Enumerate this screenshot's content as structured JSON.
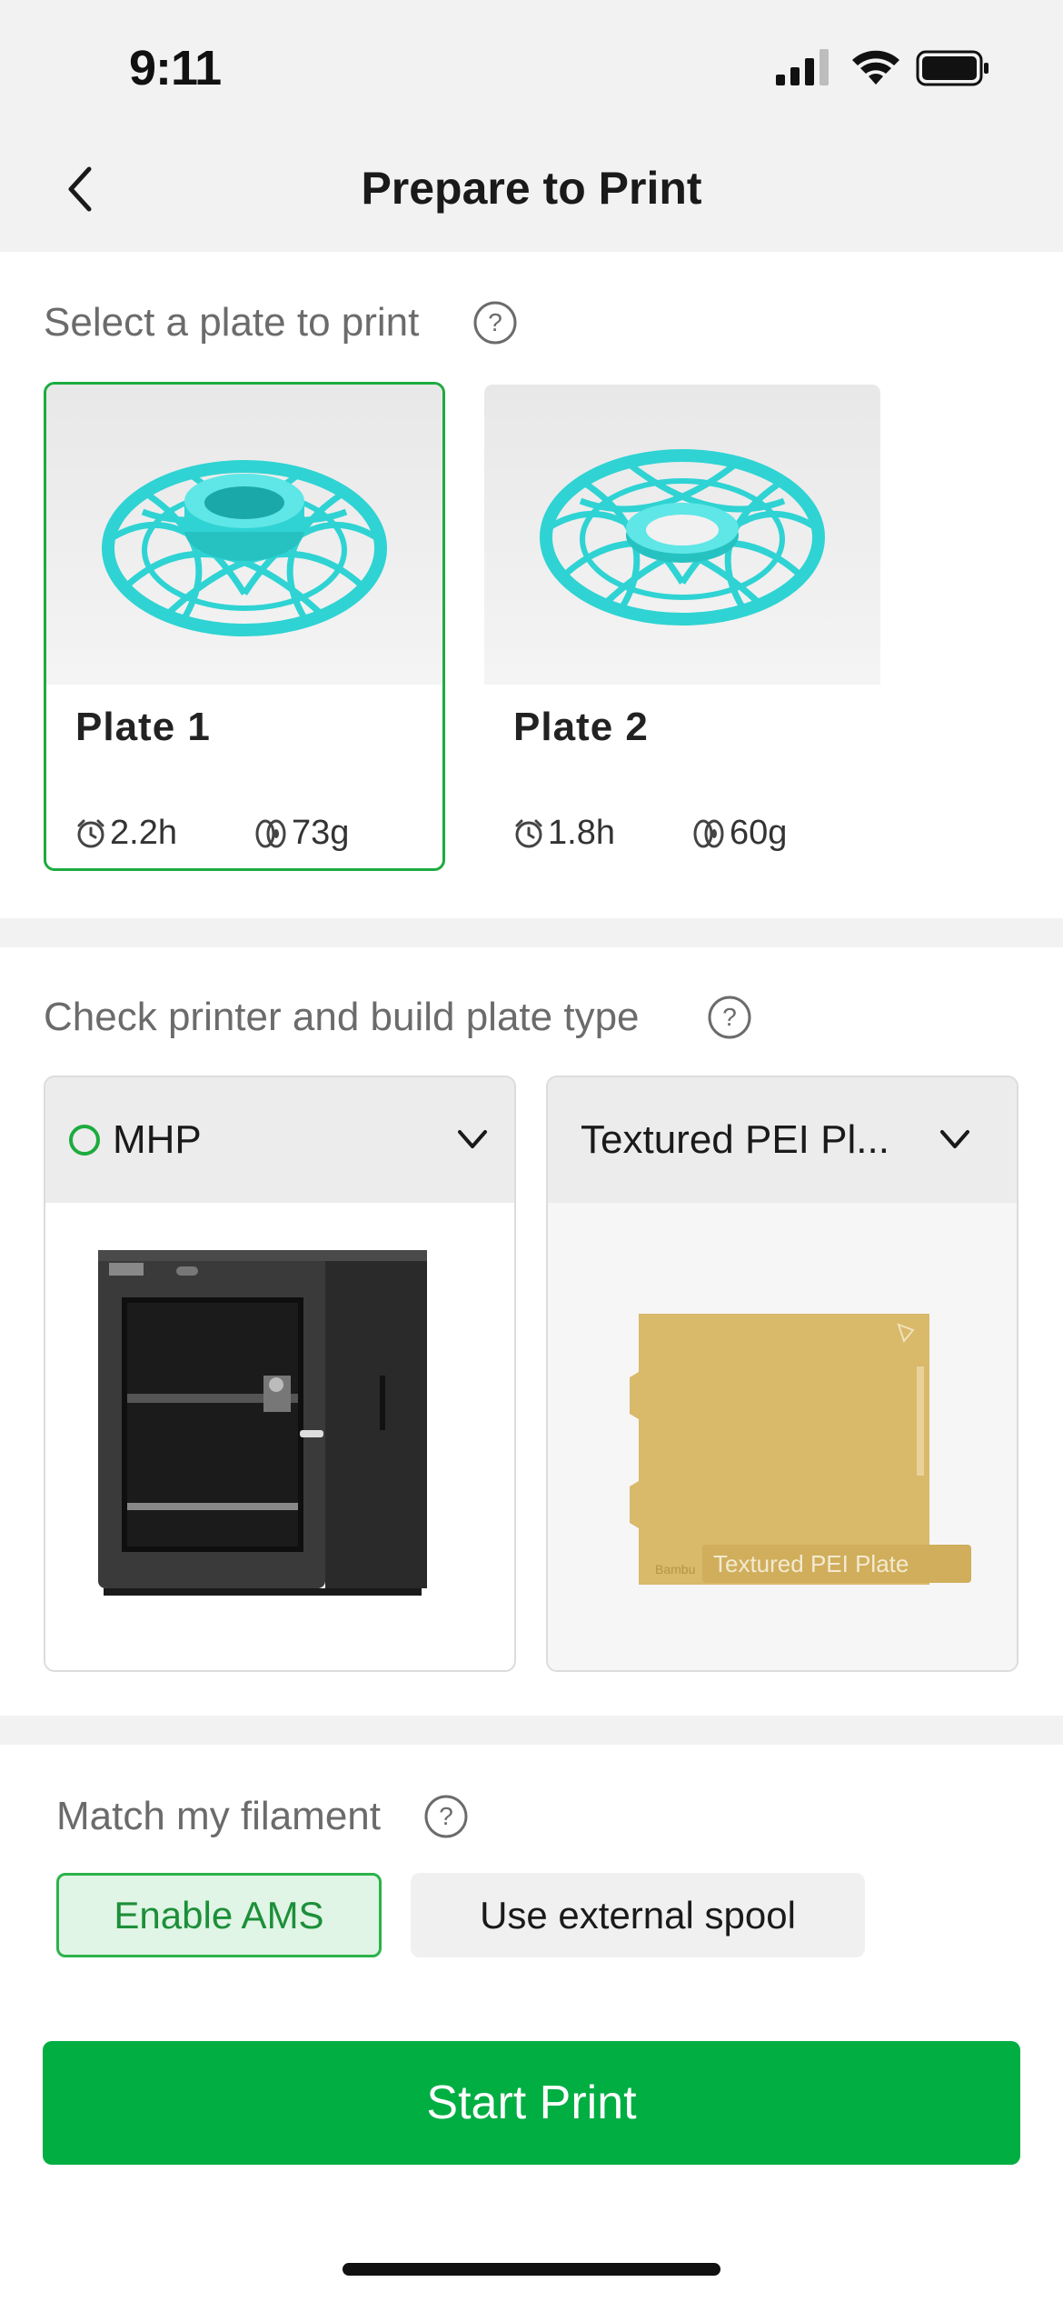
{
  "status_bar": {
    "time": "9:11"
  },
  "header": {
    "title": "Prepare to Print"
  },
  "plates_section": {
    "label": "Select a plate to print",
    "plates": [
      {
        "name": "Plate 1",
        "time": "2.2h",
        "weight": "73g",
        "selected": true
      },
      {
        "name": "Plate 2",
        "time": "1.8h",
        "weight": "60g",
        "selected": false
      }
    ]
  },
  "printer_section": {
    "label": "Check printer and build plate type",
    "printer": {
      "name": "MHP",
      "status_color": "#1dab3f"
    },
    "build_plate": {
      "name": "Textured PEI Pl...",
      "image_caption": "Textured PEI Plate",
      "image_brand": "Bambu"
    }
  },
  "filament_section": {
    "label": "Match my filament",
    "enable_ams_label": "Enable AMS",
    "external_spool_label": "Use external spool"
  },
  "start_print_label": "Start Print",
  "colors": {
    "accent": "#00ae42",
    "model": "#2fd3d3",
    "plate_gold": "#d9b96a"
  }
}
